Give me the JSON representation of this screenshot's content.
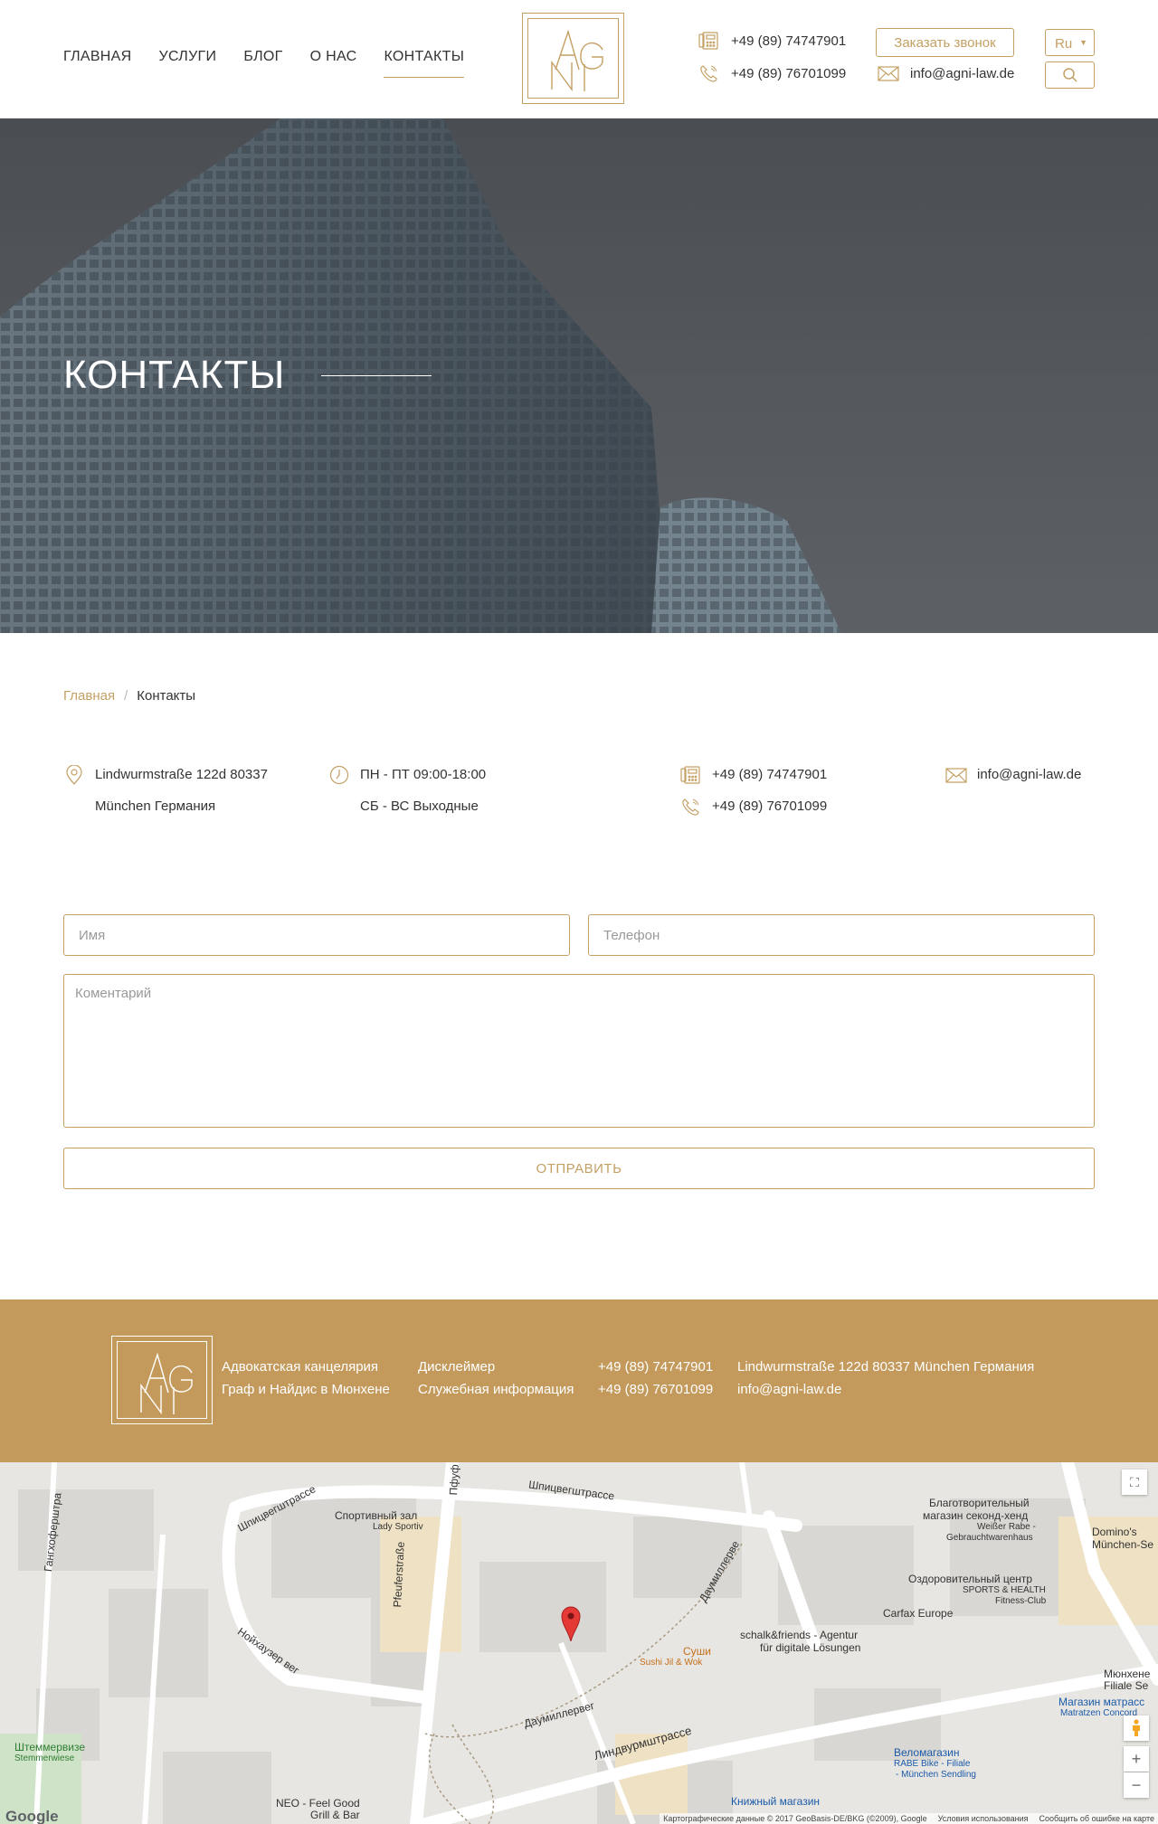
{
  "header": {
    "nav": [
      "ГЛАВНАЯ",
      "УСЛУГИ",
      "БЛОГ",
      "О НАС",
      "КОНТАКТЫ"
    ],
    "phone1": "+49 (89) 74747901",
    "phone2": "+49 (89) 76701099",
    "callback_label": "Заказать звонок",
    "email": "info@agni-law.de",
    "lang": "Ru"
  },
  "hero": {
    "title": "КОНТАКТЫ"
  },
  "breadcrumb": {
    "home": "Главная",
    "sep": "/",
    "current": "Контакты"
  },
  "contacts": {
    "address1": "Lindwurmstraße 122d 80337",
    "address2": "München Германия",
    "hours1": "ПН - ПТ 09:00-18:00",
    "hours2": "СБ - ВС Выходные",
    "phone1": "+49 (89) 74747901",
    "phone2": "+49 (89) 76701099",
    "email": "info@agni-law.de"
  },
  "form": {
    "name_placeholder": "Имя",
    "phone_placeholder": "Телефон",
    "comment_placeholder": "Коментарий",
    "submit_label": "ОТПРАВИТЬ"
  },
  "footer": {
    "company1": "Адвокатская канцелярия",
    "company2": "Граф и Найдис в Мюнхене",
    "link1": "Дисклеймер",
    "link2": "Служебная информация",
    "phone1": "+49 (89) 74747901",
    "phone2": "+49 (89) 76701099",
    "address": "Lindwurmstraße 122d 80337 München Германия",
    "email": "info@agni-law.de"
  },
  "map": {
    "labels": {
      "spitz1": "Шпицвегштрассе",
      "spitz2": "Шпицвегштрассе",
      "pfeuf": "Pfeuferstraße",
      "pfuf_top": "Пфуф",
      "gang": "Гангхоферштра",
      "neu": "Нойхаузер вег",
      "daum1": "Даумиллерве",
      "daum2": "Даумиллервег",
      "lind": "Линдвурмштрассе",
      "sport": "Спортивный зал",
      "sport_sub": "Lady Sportiv",
      "charity": "Благотворительный",
      "charity2": "магазин секонд-хенд",
      "charity3": "Weißer Rabe -",
      "charity4": "Gebrauchtwarenhaus",
      "dominos": "Domino's",
      "dominos2": "München-Se",
      "health": "Оздоровительный центр",
      "health2": "SPORTS & HEALTH",
      "health3": "Fitness-Club",
      "carfax": "Carfax Europe",
      "schalk": "schalk&friends - Agentur",
      "schalk2": "für digitale Lösungen",
      "sushi": "Суши",
      "sushi2": "Sushi Jil & Wok",
      "munchen": "Мюнхене",
      "filiale": "Filiale Se",
      "matr": "Магазин матрасс",
      "matr2": "Matratzen Concord",
      "velo": "Веломагазин",
      "velo2": "RABE Bike - Filiale",
      "velo3": "- München Sendling",
      "book": "Книжный магазин",
      "stem": "Штеммервизе",
      "stem2": "Stemmerwiese",
      "neo": "NEO - Feel Good",
      "neo2": "Grill & Bar"
    },
    "google": "Google",
    "copyright": "Картографические данные © 2017 GeoBasis-DE/BKG (©2009), Google",
    "terms": "Условия использования",
    "report": "Сообщить об ошибке на карте"
  },
  "colors": {
    "accent": "#c4a064",
    "footer_bg": "#c49a5c"
  },
  "icons": [
    "phone-icon",
    "mobile-icon",
    "mail-icon",
    "search-icon",
    "location-icon",
    "clock-icon",
    "map-pin-icon",
    "fullscreen-icon",
    "pegman-icon",
    "zoom-in-icon",
    "zoom-out-icon"
  ]
}
